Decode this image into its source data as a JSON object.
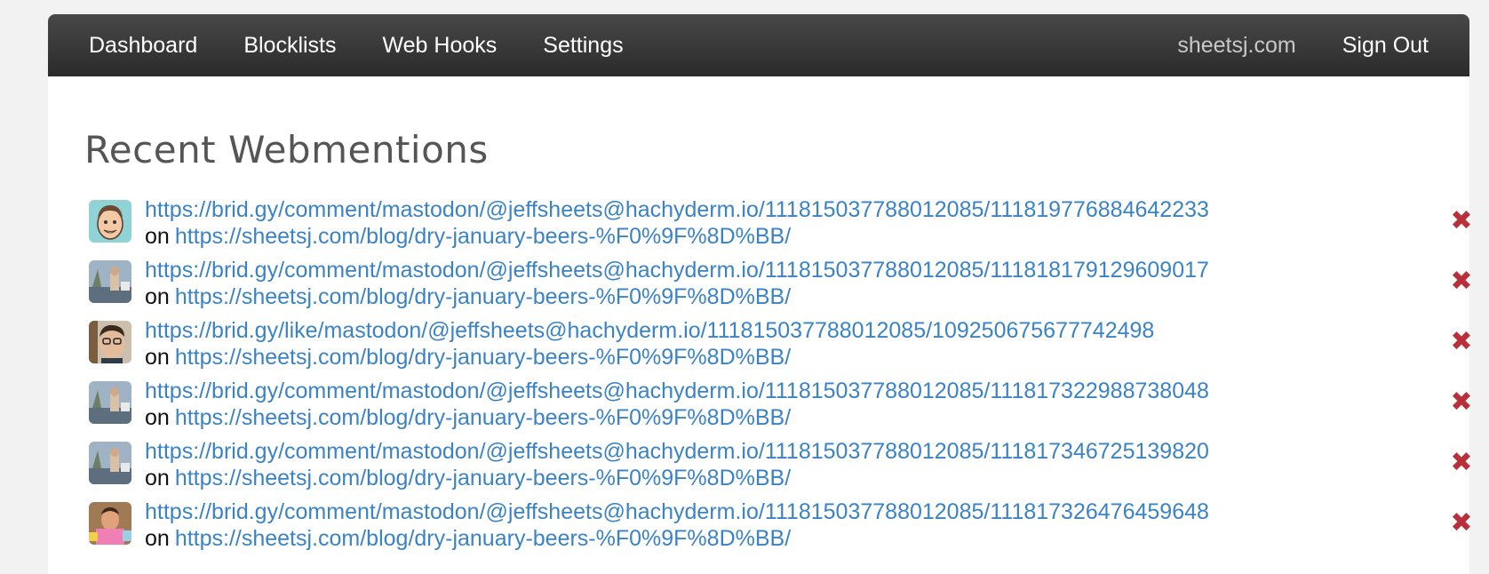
{
  "nav": {
    "left": [
      {
        "label": "Dashboard"
      },
      {
        "label": "Blocklists"
      },
      {
        "label": "Web Hooks"
      },
      {
        "label": "Settings"
      }
    ],
    "site": "sheetsj.com",
    "sign_out": "Sign Out"
  },
  "page": {
    "title": "Recent Webmentions"
  },
  "mentions": [
    {
      "avatar": "cartoon-face-avatar",
      "source": "https://brid.gy/comment/mastodon/@jeffsheets@hachyderm.io/111815037788012085/111819776884642233",
      "on_label": "on",
      "target": "https://sheetsj.com/blog/dry-january-beers-%F0%9F%8D%BB/"
    },
    {
      "avatar": "photo-avatar",
      "source": "https://brid.gy/comment/mastodon/@jeffsheets@hachyderm.io/111815037788012085/111818179129609017",
      "on_label": "on",
      "target": "https://sheetsj.com/blog/dry-january-beers-%F0%9F%8D%BB/"
    },
    {
      "avatar": "bearded-person-avatar",
      "source": "https://brid.gy/like/mastodon/@jeffsheets@hachyderm.io/111815037788012085/109250675677742498",
      "on_label": "on",
      "target": "https://sheetsj.com/blog/dry-january-beers-%F0%9F%8D%BB/"
    },
    {
      "avatar": "photo-avatar",
      "source": "https://brid.gy/comment/mastodon/@jeffsheets@hachyderm.io/111815037788012085/111817322988738048",
      "on_label": "on",
      "target": "https://sheetsj.com/blog/dry-january-beers-%F0%9F%8D%BB/"
    },
    {
      "avatar": "photo-avatar",
      "source": "https://brid.gy/comment/mastodon/@jeffsheets@hachyderm.io/111815037788012085/111817346725139820",
      "on_label": "on",
      "target": "https://sheetsj.com/blog/dry-january-beers-%F0%9F%8D%BB/"
    },
    {
      "avatar": "colorful-person-avatar",
      "source": "https://brid.gy/comment/mastodon/@jeffsheets@hachyderm.io/111815037788012085/111817326476459648",
      "on_label": "on",
      "target": "https://sheetsj.com/blog/dry-january-beers-%F0%9F%8D%BB/"
    }
  ],
  "delete_glyph": "✖",
  "colors": {
    "link": "#3b83c4",
    "delete": "#b8313a",
    "navbar": "#333333"
  }
}
